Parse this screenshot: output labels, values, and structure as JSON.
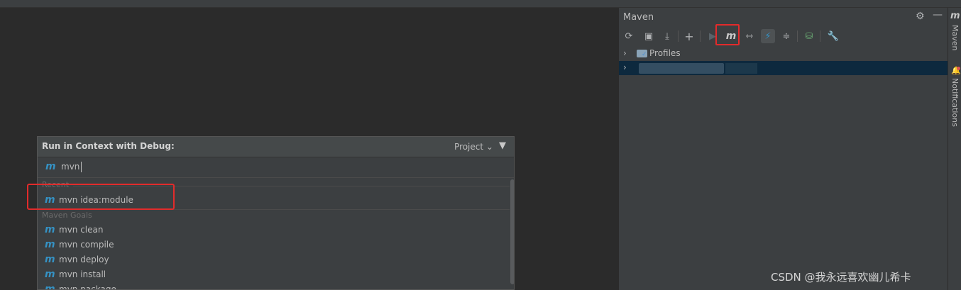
{
  "maven": {
    "title": "Maven",
    "header_icons": [
      "gear-icon",
      "minimize-icon"
    ],
    "toolbar": [
      {
        "name": "reload-icon",
        "glyph": "⟳"
      },
      {
        "name": "add-sources-icon",
        "glyph": "▣"
      },
      {
        "name": "download-icon",
        "glyph": "⤓"
      },
      {
        "name": "add-project-icon",
        "glyph": "+"
      },
      {
        "name": "run-icon",
        "glyph": "▶"
      },
      {
        "name": "execute-goal-icon",
        "glyph": "m"
      },
      {
        "name": "toggle-offline-icon",
        "glyph": "⇿"
      },
      {
        "name": "skip-tests-icon",
        "glyph": "⚡"
      },
      {
        "name": "collapse-all-icon",
        "glyph": "≑"
      },
      {
        "name": "show-dependencies-icon",
        "glyph": "⛁"
      },
      {
        "name": "settings-wrench-icon",
        "glyph": "🔧"
      }
    ],
    "tree": {
      "profiles_label": "Profiles"
    }
  },
  "stripe": {
    "maven_label": "Maven",
    "notifications_label": "Notifications"
  },
  "popup": {
    "title": "Run in Context with Debug:",
    "scope": "Project ⌄",
    "input_value": "mvn",
    "recent_section": "Recent",
    "recent_items": [
      "mvn idea:module"
    ],
    "goals_section": "Maven Goals",
    "goal_items": [
      "mvn clean",
      "mvn compile",
      "mvn deploy",
      "mvn install",
      "mvn package"
    ]
  },
  "watermark": "CSDN @我永远喜欢幽儿希卡",
  "colors": {
    "highlight_border": "#e22b2b",
    "maven_icon_blue": "#3592c4",
    "selection_blue": "#0d293e"
  }
}
